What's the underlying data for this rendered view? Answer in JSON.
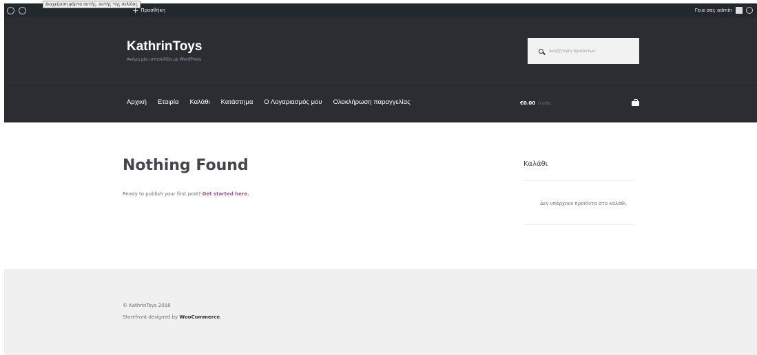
{
  "admin_bar": {
    "tooltip": "Διαχείριση φόρτα αυτής, αυτής της σελίδας",
    "new_label": "Προσθήκη",
    "greeting": "Γεια σας admin"
  },
  "header": {
    "site_title": "KathrinToys",
    "site_description": "Ακόμη μία ιστοσελίδα με WordPress",
    "search_placeholder": "Αναζήτηση προϊόντων"
  },
  "nav": {
    "items": [
      "Αρχική",
      "Εταιρία",
      "Καλάθι",
      "Κατάστημα",
      "Ο Λογαριασμός μου",
      "Ολοκλήρωση παραγγελίας"
    ]
  },
  "cart": {
    "total": "€0.00",
    "count": "0 είδη"
  },
  "main": {
    "title": "Nothing Found",
    "text": "Ready to publish your first post?",
    "link": "Get started here."
  },
  "sidebar": {
    "widget_title": "Καλάθι",
    "empty_text": "Δεν υπάρχουν προϊόντα στο καλάθι."
  },
  "footer": {
    "copyright": "© KathrinToys 2016",
    "credit_prefix": "Storefront designed by",
    "credit_brand": "WooCommerce",
    "credit_suffix": "."
  }
}
